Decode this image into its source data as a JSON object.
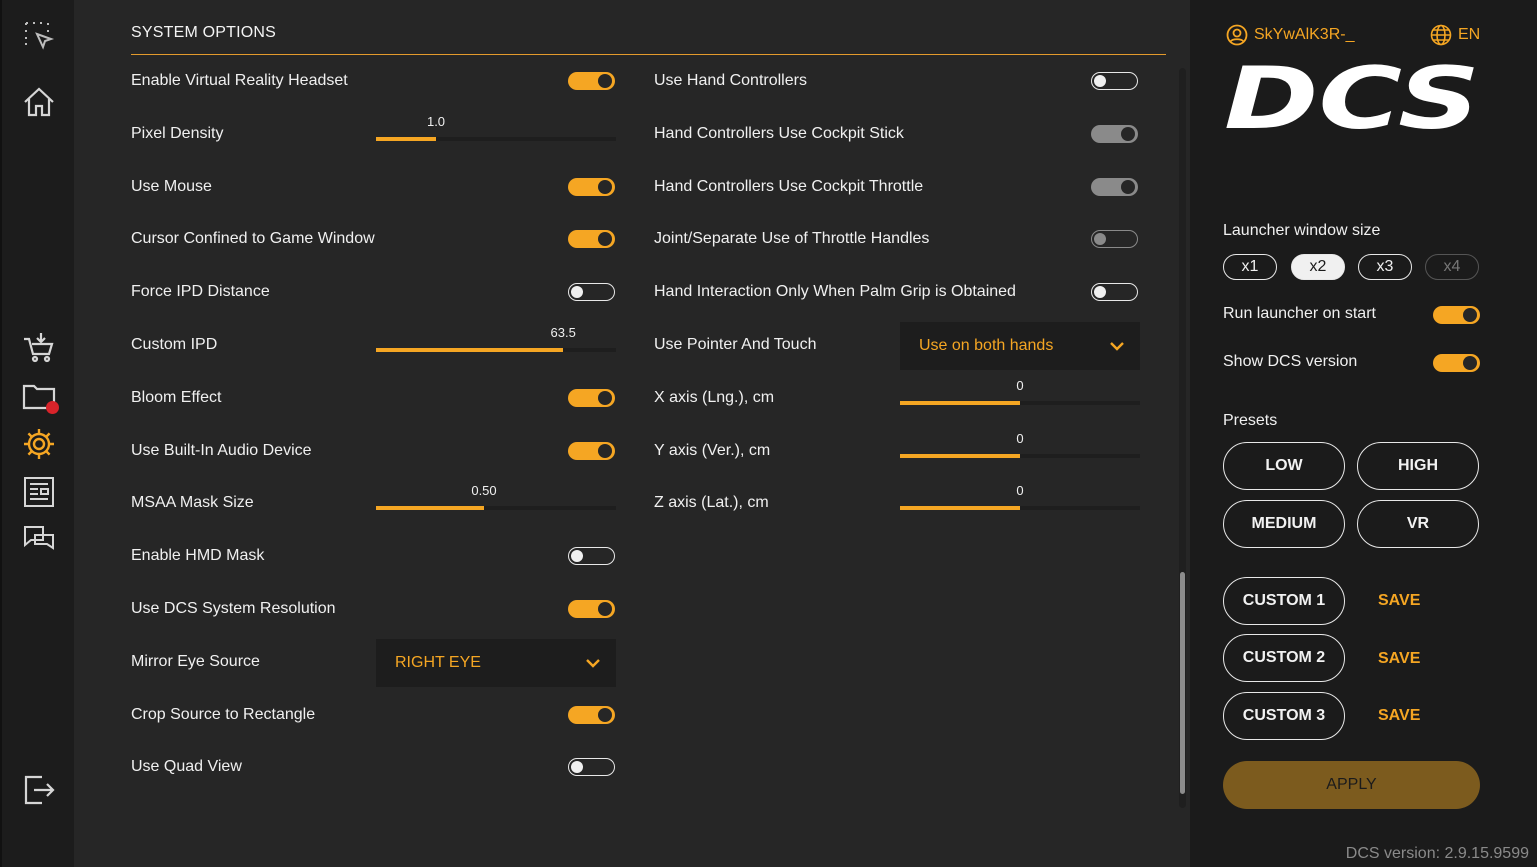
{
  "section_title": "SYSTEM OPTIONS",
  "left_options": [
    {
      "label": "Enable Virtual Reality Headset",
      "control": "toggle",
      "state": "on"
    },
    {
      "label": "Pixel Density",
      "control": "slider",
      "value": "1.0",
      "fill": 0.25
    },
    {
      "label": "Use Mouse",
      "control": "toggle",
      "state": "on"
    },
    {
      "label": "Cursor Confined to Game Window",
      "control": "toggle",
      "state": "on"
    },
    {
      "label": "Force IPD Distance",
      "control": "toggle",
      "state": "off"
    },
    {
      "label": "Custom IPD",
      "control": "slider",
      "value": "63.5",
      "fill": 0.78
    },
    {
      "label": "Bloom Effect",
      "control": "toggle",
      "state": "on"
    },
    {
      "label": "Use Built-In Audio Device",
      "control": "toggle",
      "state": "on"
    },
    {
      "label": "MSAA Mask Size",
      "control": "slider",
      "value": "0.50",
      "fill": 0.45
    },
    {
      "label": "Enable HMD Mask",
      "control": "toggle",
      "state": "off"
    },
    {
      "label": "Use DCS System Resolution",
      "control": "toggle",
      "state": "on"
    },
    {
      "label": "Mirror Eye Source",
      "control": "dropdown",
      "value": "RIGHT EYE"
    },
    {
      "label": "Crop Source to Rectangle",
      "control": "toggle",
      "state": "on"
    },
    {
      "label": "Use Quad View",
      "control": "toggle",
      "state": "off"
    }
  ],
  "right_options": [
    {
      "label": "Use Hand Controllers",
      "control": "toggle",
      "state": "off"
    },
    {
      "label": "Hand Controllers Use Cockpit Stick",
      "control": "toggle",
      "state": "disabled-on"
    },
    {
      "label": "Hand Controllers Use Cockpit Throttle",
      "control": "toggle",
      "state": "disabled-on"
    },
    {
      "label": "Joint/Separate Use of Throttle Handles",
      "control": "toggle",
      "state": "disabled-off"
    },
    {
      "label": "Hand Interaction Only When Palm Grip is Obtained",
      "control": "toggle",
      "state": "off"
    },
    {
      "label": "Use Pointer And Touch",
      "control": "dropdown",
      "value": "Use on both hands"
    },
    {
      "label": "X axis (Lng.), cm",
      "control": "slider",
      "value": "0",
      "fill": 0.5
    },
    {
      "label": "Y axis (Ver.), cm",
      "control": "slider",
      "value": "0",
      "fill": 0.5
    },
    {
      "label": "Z axis (Lat.), cm",
      "control": "slider",
      "value": "0",
      "fill": 0.5
    }
  ],
  "panel": {
    "username": "SkYwAlK3R-_",
    "language": "EN",
    "logo_text": "DCS",
    "launcher_size_label": "Launcher window size",
    "sizes": [
      "x1",
      "x2",
      "x3",
      "x4"
    ],
    "run_on_start_label": "Run launcher on start",
    "show_version_label": "Show DCS version",
    "presets_label": "Presets",
    "presets": [
      "LOW",
      "HIGH",
      "MEDIUM",
      "VR"
    ],
    "customs": [
      "CUSTOM 1",
      "CUSTOM 2",
      "CUSTOM 3"
    ],
    "save_label": "SAVE",
    "apply_label": "APPLY",
    "version": "DCS version: 2.9.15.9599"
  },
  "colors": {
    "accent": "#f5a623",
    "bg": "#262626",
    "panel": "#1b1b1b"
  }
}
